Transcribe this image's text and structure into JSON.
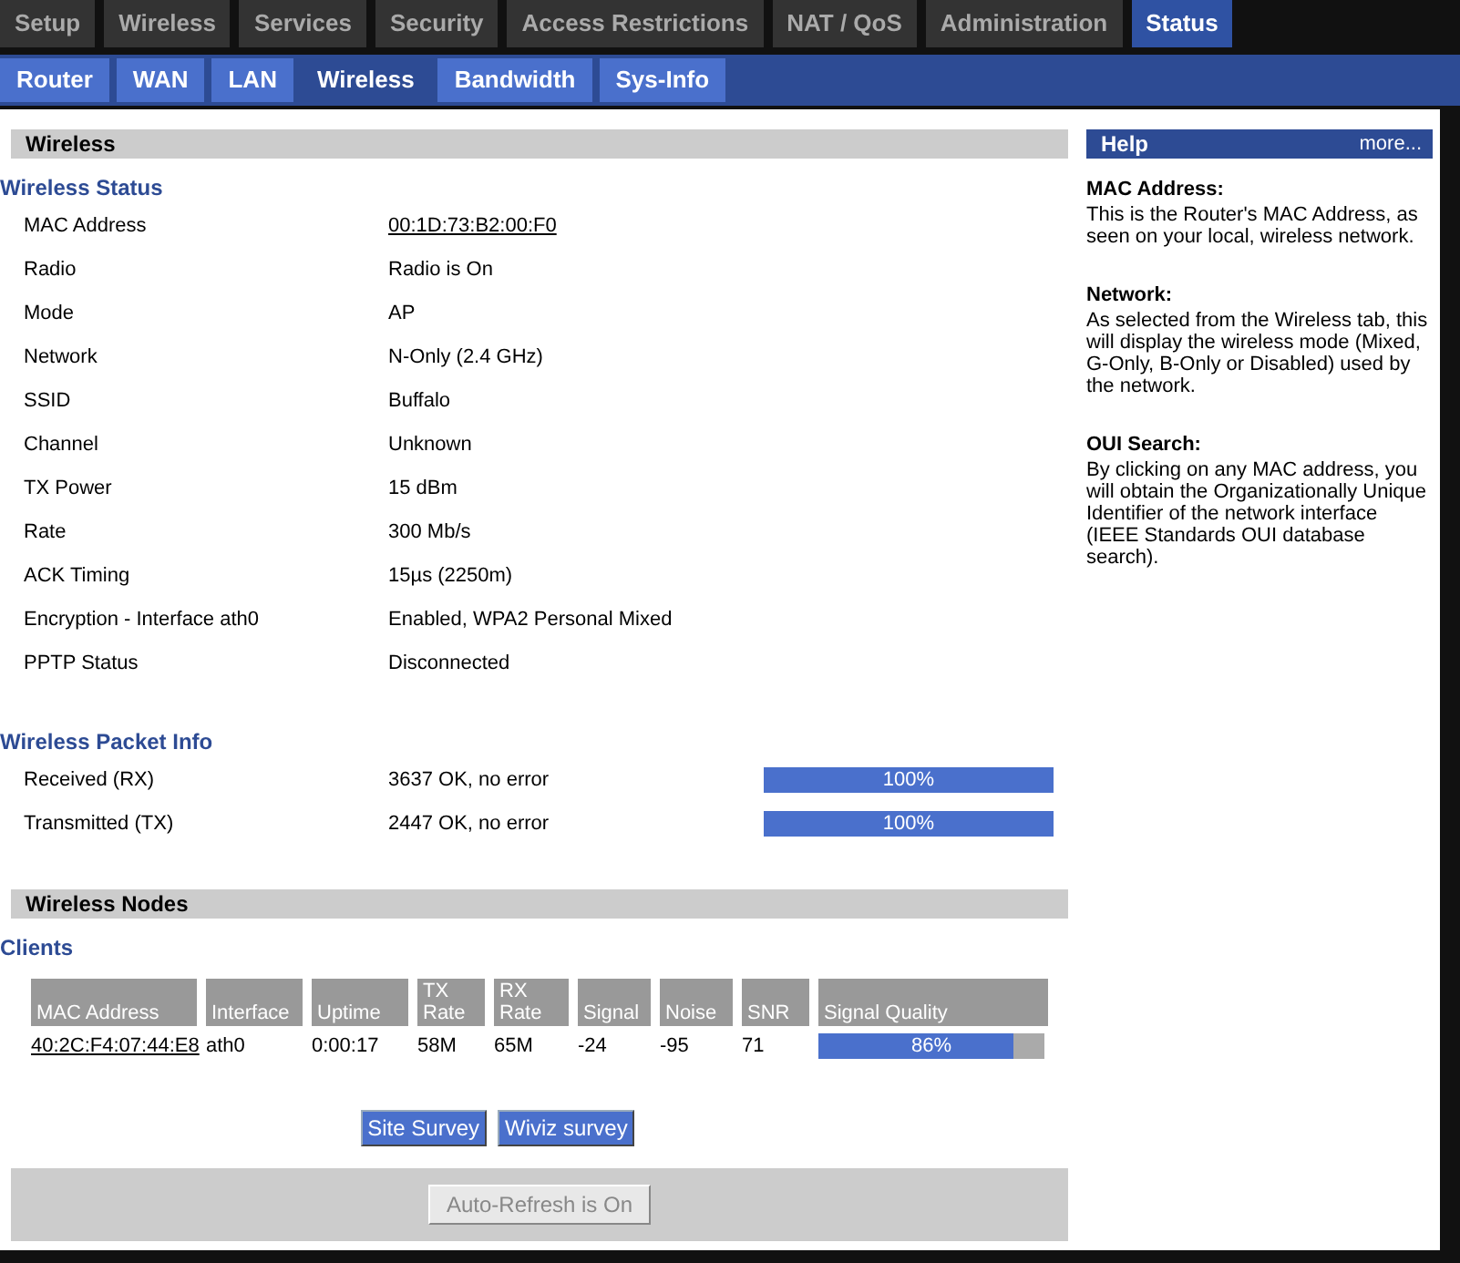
{
  "main_tabs": [
    {
      "label": "Setup",
      "selected": false
    },
    {
      "label": "Wireless",
      "selected": false
    },
    {
      "label": "Services",
      "selected": false
    },
    {
      "label": "Security",
      "selected": false
    },
    {
      "label": "Access Restrictions",
      "selected": false
    },
    {
      "label": "NAT / QoS",
      "selected": false
    },
    {
      "label": "Administration",
      "selected": false
    },
    {
      "label": "Status",
      "selected": true
    }
  ],
  "sub_tabs": [
    {
      "label": "Router",
      "selected": false
    },
    {
      "label": "WAN",
      "selected": false
    },
    {
      "label": "LAN",
      "selected": false
    },
    {
      "label": "Wireless",
      "selected": true
    },
    {
      "label": "Bandwidth",
      "selected": false
    },
    {
      "label": "Sys-Info",
      "selected": false
    }
  ],
  "section_title": "Wireless",
  "wireless_status": {
    "title": "Wireless Status",
    "rows": [
      {
        "label": "MAC Address",
        "value": "00:1D:73:B2:00:F0",
        "kind": "link"
      },
      {
        "label": "Radio",
        "value": "Radio is On",
        "kind": "text"
      },
      {
        "label": "Mode",
        "value": "AP",
        "kind": "text"
      },
      {
        "label": "Network",
        "value": "N-Only (2.4 GHz)",
        "kind": "text"
      },
      {
        "label": "SSID",
        "value": "Buffalo",
        "kind": "text"
      },
      {
        "label": "Channel",
        "value": "Unknown",
        "kind": "text"
      },
      {
        "label": "TX Power",
        "value": "15 dBm",
        "kind": "text"
      },
      {
        "label": "Rate",
        "value": "300 Mb/s",
        "kind": "text"
      },
      {
        "label": "ACK Timing",
        "value": "15µs (2250m)",
        "kind": "text"
      },
      {
        "label": "Encryption - Interface ath0",
        "value": "Enabled, WPA2 Personal Mixed",
        "kind": "text"
      },
      {
        "label": "PPTP Status",
        "value": "Disconnected",
        "kind": "text"
      }
    ]
  },
  "packet_info": {
    "title": "Wireless Packet Info",
    "rows": [
      {
        "label": "Received (RX)",
        "value": "3637 OK, no error",
        "level": 1,
        "reading": "100%"
      },
      {
        "label": "Transmitted (TX)",
        "value": "2447 OK, no error",
        "level": 1,
        "reading": "100%"
      }
    ]
  },
  "nodes_title": "Wireless Nodes",
  "clients": {
    "title": "Clients",
    "columns": [
      "MAC Address",
      "Interface",
      "Uptime",
      "TX\nRate",
      "RX\nRate",
      "Signal",
      "Noise",
      "SNR",
      "Signal Quality"
    ],
    "rows": [
      {
        "cells": [
          "40:2C:F4:07:44:E8",
          "ath0",
          "0:00:17",
          "58M",
          "65M",
          "-24",
          "-95",
          "71"
        ],
        "level": 0.86,
        "reading": "86%"
      }
    ]
  },
  "survey_buttons": [
    "Site Survey",
    "Wiviz survey"
  ],
  "refresh_button": {
    "label": "Auto-Refresh is On",
    "disabled": true
  },
  "help": {
    "title": "Help",
    "more": "more...",
    "entries": [
      {
        "title": "MAC Address:",
        "text": "This is the Router's MAC Address, as seen on your local, wireless network."
      },
      {
        "title": "Network:",
        "text": "As selected from the Wireless tab, this will display the wireless mode (Mixed, G-Only, B-Only or Disabled) used by the network."
      },
      {
        "title": "OUI Search:",
        "text": "By clicking on any MAC address, you will obtain the Organizationally Unique Identifier of the network interface (IEEE Standards OUI database search)."
      }
    ]
  }
}
